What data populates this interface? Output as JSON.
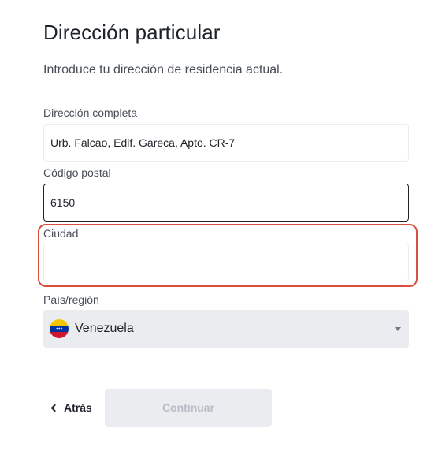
{
  "header": {
    "title": "Dirección particular",
    "subtitle": "Introduce tu dirección de residencia actual."
  },
  "form": {
    "address": {
      "label": "Dirección completa",
      "value": "Urb. Falcao, Edif. Gareca, Apto. CR-7"
    },
    "postal_code": {
      "label": "Código postal",
      "value": "6150"
    },
    "city": {
      "label": "Ciudad",
      "value": ""
    },
    "country": {
      "label": "País/región",
      "selected": "Venezuela",
      "flag_icon": "venezuela-flag-icon",
      "flag_colors": [
        "#f7c600",
        "#0033a0",
        "#cf142b"
      ]
    }
  },
  "actions": {
    "back_label": "Atrás",
    "continue_label": "Continuar"
  },
  "colors": {
    "focus_border": "#1e2329",
    "highlight": "#d9503f",
    "disabled_bg": "#eaecef",
    "disabled_text": "#b7bdc6"
  }
}
